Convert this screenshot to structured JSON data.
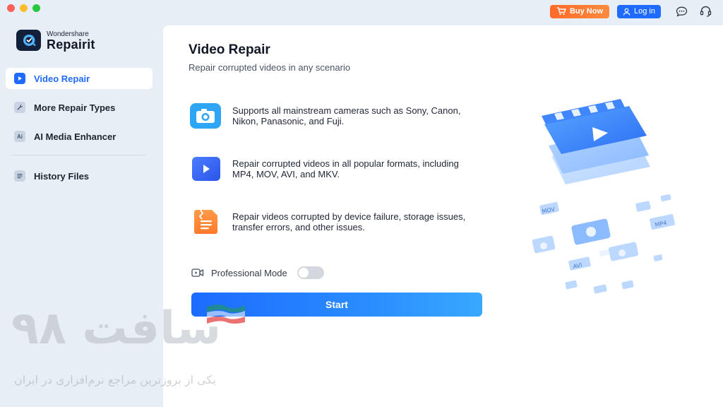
{
  "window": {
    "controls": [
      "close",
      "minimize",
      "zoom"
    ]
  },
  "topbar": {
    "buy_label": "Buy Now",
    "login_label": "Log in",
    "icons": [
      "chat-icon",
      "headset-icon"
    ]
  },
  "app": {
    "brand_small": "Wondershare",
    "brand_big": "Repairit"
  },
  "sidebar": {
    "items": [
      {
        "label": "Video Repair",
        "icon": "video-repair-icon",
        "active": true
      },
      {
        "label": "More Repair Types",
        "icon": "wrench-icon",
        "active": false
      },
      {
        "label": "AI Media Enhancer",
        "icon": "ai-icon",
        "active": false
      },
      {
        "label": "History Files",
        "icon": "history-icon",
        "active": false
      }
    ]
  },
  "main": {
    "title": "Video Repair",
    "subtitle": "Repair corrupted videos in any scenario",
    "features": [
      {
        "icon": "camera-icon",
        "text": "Supports all mainstream cameras such as Sony, Canon, Nikon, Panasonic, and Fuji."
      },
      {
        "icon": "video-file-icon",
        "text": "Repair corrupted videos in all popular formats, including MP4, MOV, AVI, and MKV."
      },
      {
        "icon": "broken-file-icon",
        "text": "Repair videos corrupted by device failure, storage issues, transfer errors, and other issues."
      }
    ],
    "professional_mode_label": "Professional Mode",
    "professional_mode_on": false,
    "start_label": "Start",
    "illustration_labels": [
      "MOV",
      "MP4",
      "AVI"
    ]
  },
  "watermark": {
    "big": "سافت ۹۸",
    "small": "یکی از بروزترین مراجع نرم‌افزاری در ایران"
  },
  "colors": {
    "accent": "#1f6bff",
    "buy": "#ff6a2a",
    "sidebar_bg": "#e8eef6"
  }
}
